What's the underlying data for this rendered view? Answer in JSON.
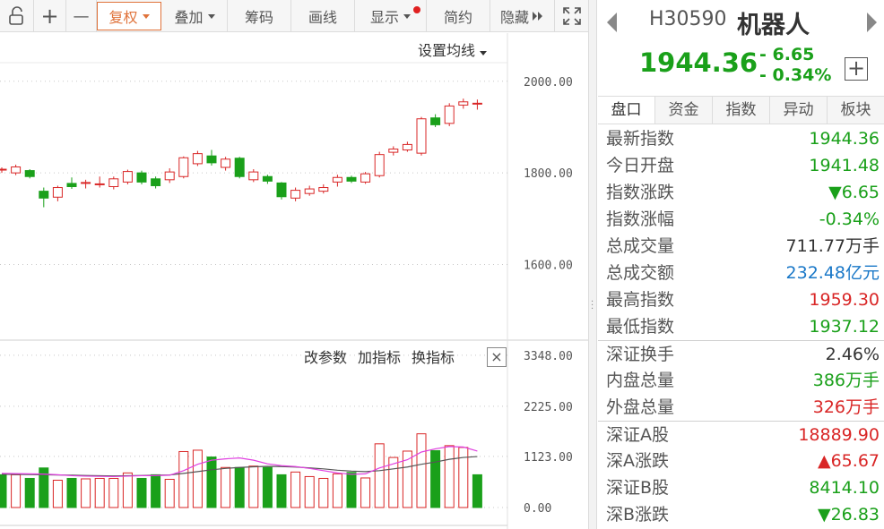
{
  "toolbar": {
    "items": [
      {
        "id": "lock",
        "icon": "lock-icon"
      },
      {
        "id": "zoom-in",
        "label": "+"
      },
      {
        "id": "zoom-out",
        "label": "—"
      },
      {
        "id": "fuquan",
        "label": "复权",
        "active": true
      },
      {
        "id": "diejia",
        "label": "叠加"
      },
      {
        "id": "chouma",
        "label": "筹码"
      },
      {
        "id": "huaxian",
        "label": "画线"
      },
      {
        "id": "xianshi",
        "label": "显示"
      },
      {
        "id": "jianyue",
        "label": "简约"
      },
      {
        "id": "yincang",
        "label": "隐藏"
      },
      {
        "id": "fullscreen",
        "icon": "fullscreen-icon"
      }
    ]
  },
  "main_chart": {
    "set_ma_label": "设置均线",
    "y_ticks": [
      "2000.00",
      "1800.00",
      "1600.00"
    ]
  },
  "indicator_panel": {
    "buttons": [
      "改参数",
      "加指标",
      "换指标"
    ],
    "close_label": "×",
    "y_ticks": [
      "3348.00",
      "2225.00",
      "1123.00",
      "0.00"
    ]
  },
  "colors": {
    "up": "#d92626",
    "down": "#1aa01a",
    "ma1": "#e040e0",
    "ma2": "#555555",
    "accent": "#e0733b"
  },
  "chart_data": {
    "type": "candlestick",
    "y_ticks": [
      2000,
      1800,
      1600
    ],
    "ylim": [
      1435,
      2105
    ],
    "candles": [
      {
        "o": 1808,
        "c": 1808,
        "h": 1812,
        "l": 1800
      },
      {
        "o": 1800,
        "c": 1813,
        "h": 1818,
        "l": 1795
      },
      {
        "o": 1805,
        "c": 1792,
        "h": 1808,
        "l": 1788
      },
      {
        "o": 1760,
        "c": 1745,
        "h": 1768,
        "l": 1725
      },
      {
        "o": 1747,
        "c": 1768,
        "h": 1772,
        "l": 1738
      },
      {
        "o": 1777,
        "c": 1770,
        "h": 1790,
        "l": 1765
      },
      {
        "o": 1777,
        "c": 1779,
        "h": 1785,
        "l": 1766
      },
      {
        "o": 1775,
        "c": 1776,
        "h": 1792,
        "l": 1768
      },
      {
        "o": 1770,
        "c": 1787,
        "h": 1792,
        "l": 1764
      },
      {
        "o": 1780,
        "c": 1803,
        "h": 1807,
        "l": 1775
      },
      {
        "o": 1800,
        "c": 1780,
        "h": 1805,
        "l": 1775
      },
      {
        "o": 1787,
        "c": 1772,
        "h": 1792,
        "l": 1766
      },
      {
        "o": 1785,
        "c": 1802,
        "h": 1810,
        "l": 1778
      },
      {
        "o": 1792,
        "c": 1833,
        "h": 1836,
        "l": 1788
      },
      {
        "o": 1820,
        "c": 1842,
        "h": 1848,
        "l": 1815
      },
      {
        "o": 1837,
        "c": 1822,
        "h": 1850,
        "l": 1816
      },
      {
        "o": 1812,
        "c": 1830,
        "h": 1835,
        "l": 1805
      },
      {
        "o": 1832,
        "c": 1792,
        "h": 1835,
        "l": 1788
      },
      {
        "o": 1785,
        "c": 1802,
        "h": 1808,
        "l": 1780
      },
      {
        "o": 1792,
        "c": 1782,
        "h": 1796,
        "l": 1776
      },
      {
        "o": 1778,
        "c": 1748,
        "h": 1780,
        "l": 1742
      },
      {
        "o": 1745,
        "c": 1762,
        "h": 1768,
        "l": 1738
      },
      {
        "o": 1755,
        "c": 1765,
        "h": 1772,
        "l": 1750
      },
      {
        "o": 1760,
        "c": 1768,
        "h": 1775,
        "l": 1755
      },
      {
        "o": 1780,
        "c": 1790,
        "h": 1796,
        "l": 1770
      },
      {
        "o": 1790,
        "c": 1782,
        "h": 1794,
        "l": 1778
      },
      {
        "o": 1780,
        "c": 1798,
        "h": 1802,
        "l": 1776
      },
      {
        "o": 1794,
        "c": 1840,
        "h": 1846,
        "l": 1790
      },
      {
        "o": 1845,
        "c": 1852,
        "h": 1858,
        "l": 1838
      },
      {
        "o": 1850,
        "c": 1862,
        "h": 1868,
        "l": 1846
      },
      {
        "o": 1843,
        "c": 1918,
        "h": 1922,
        "l": 1838
      },
      {
        "o": 1920,
        "c": 1905,
        "h": 1928,
        "l": 1900
      },
      {
        "o": 1908,
        "c": 1946,
        "h": 1952,
        "l": 1902
      },
      {
        "o": 1948,
        "c": 1955,
        "h": 1962,
        "l": 1940
      },
      {
        "o": 1952,
        "c": 1952,
        "h": 1960,
        "l": 1938
      }
    ],
    "volume": {
      "y_ticks": [
        3348,
        2225,
        1123,
        0
      ],
      "ylim": [
        0,
        3620
      ],
      "values": [
        720,
        720,
        640,
        870,
        600,
        640,
        630,
        640,
        640,
        760,
        640,
        720,
        620,
        1230,
        1260,
        1110,
        880,
        880,
        910,
        880,
        720,
        780,
        680,
        640,
        740,
        770,
        650,
        1400,
        1100,
        1240,
        1620,
        1250,
        1360,
        1320,
        720
      ],
      "ma1": [
        750,
        745,
        740,
        735,
        720,
        700,
        690,
        685,
        680,
        690,
        700,
        700,
        710,
        810,
        950,
        1040,
        1070,
        1090,
        1040,
        960,
        920,
        900,
        860,
        810,
        760,
        730,
        740,
        870,
        960,
        1050,
        1220,
        1290,
        1340,
        1330,
        1240
      ],
      "ma2": [
        730,
        728,
        725,
        720,
        715,
        710,
        705,
        700,
        695,
        700,
        705,
        710,
        715,
        750,
        790,
        830,
        860,
        880,
        895,
        905,
        900,
        890,
        870,
        850,
        820,
        800,
        790,
        810,
        850,
        890,
        950,
        1000,
        1060,
        1100,
        1120
      ],
      "up_days": [
        1,
        4,
        6,
        7,
        8,
        9,
        12,
        13,
        14,
        16,
        18,
        21,
        22,
        23,
        24,
        26,
        27,
        28,
        29,
        30,
        32,
        33
      ]
    }
  },
  "quote": {
    "code": "H30590",
    "name": "机器人",
    "price": "1944.36",
    "change": "- 6.65",
    "change_pct": "- 0.34%",
    "tabs": [
      "盘口",
      "资金",
      "指数",
      "异动",
      "板块"
    ],
    "rows": [
      {
        "label": "最新指数",
        "value": "1944.36",
        "color": "g"
      },
      {
        "label": "今日开盘",
        "value": "1941.48",
        "color": "g"
      },
      {
        "label": "指数涨跌",
        "value": "▼6.65",
        "color": "g"
      },
      {
        "label": "指数涨幅",
        "value": "-0.34%",
        "color": "g"
      },
      {
        "label": "总成交量",
        "value": "711.77万手",
        "color": "k"
      },
      {
        "label": "总成交额",
        "value": "232.48亿元",
        "color": "b"
      },
      {
        "label": "最高指数",
        "value": "1959.30",
        "color": "r"
      },
      {
        "label": "最低指数",
        "value": "1937.12",
        "color": "g"
      },
      {
        "label": "深证换手",
        "value": "2.46%",
        "color": "k",
        "sep": true
      },
      {
        "label": "内盘总量",
        "value": "386万手",
        "color": "g"
      },
      {
        "label": "外盘总量",
        "value": "326万手",
        "color": "r"
      },
      {
        "label": "深证A股",
        "value": "18889.90",
        "color": "r",
        "sep": true
      },
      {
        "label": "深A涨跌",
        "value": "▲65.67",
        "color": "r"
      },
      {
        "label": "深证B股",
        "value": "8414.10",
        "color": "g"
      },
      {
        "label": "深B涨跌",
        "value": "▼26.83",
        "color": "g"
      }
    ]
  }
}
